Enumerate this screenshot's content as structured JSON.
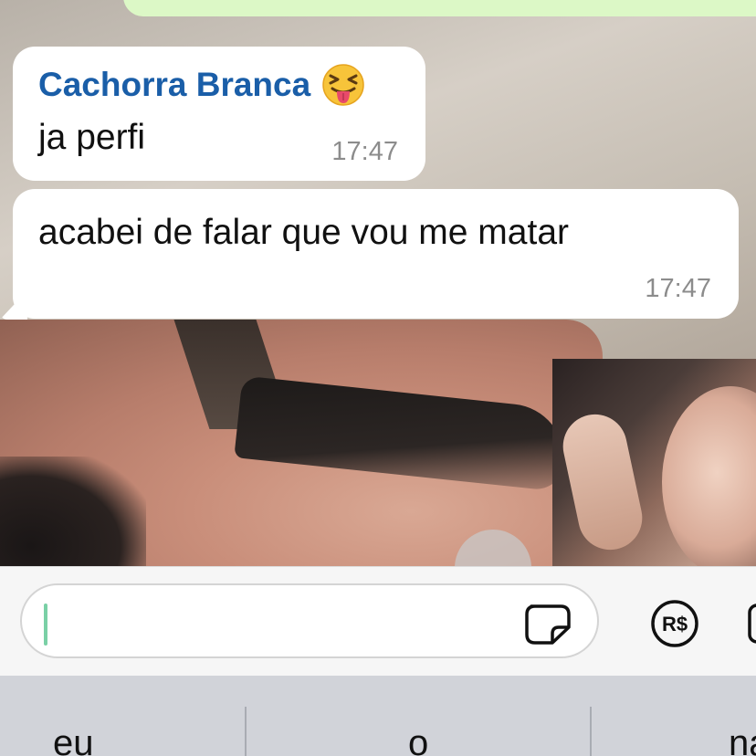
{
  "colors": {
    "outgoing_bubble": "#dcf8c6",
    "incoming_bubble": "#ffffff",
    "sender_name": "#1a5ea8",
    "timestamp": "#8c8c8c",
    "caret": "#7ad0a6"
  },
  "messages": [
    {
      "sender": "Cachorra Branca",
      "sender_emoji_icon": "squinting-face-with-tongue-icon",
      "text": "ja perfi",
      "time": "17:47"
    },
    {
      "text": "acabei de falar que vou me matar",
      "time": "17:47"
    }
  ],
  "input": {
    "value": "",
    "sticker_icon": "sticker-icon",
    "payment_icon": "payment-rs-icon",
    "payment_symbol": "R$",
    "camera_icon": "camera-icon"
  },
  "keyboard": {
    "suggestions": [
      "eu",
      "o",
      "na"
    ]
  }
}
